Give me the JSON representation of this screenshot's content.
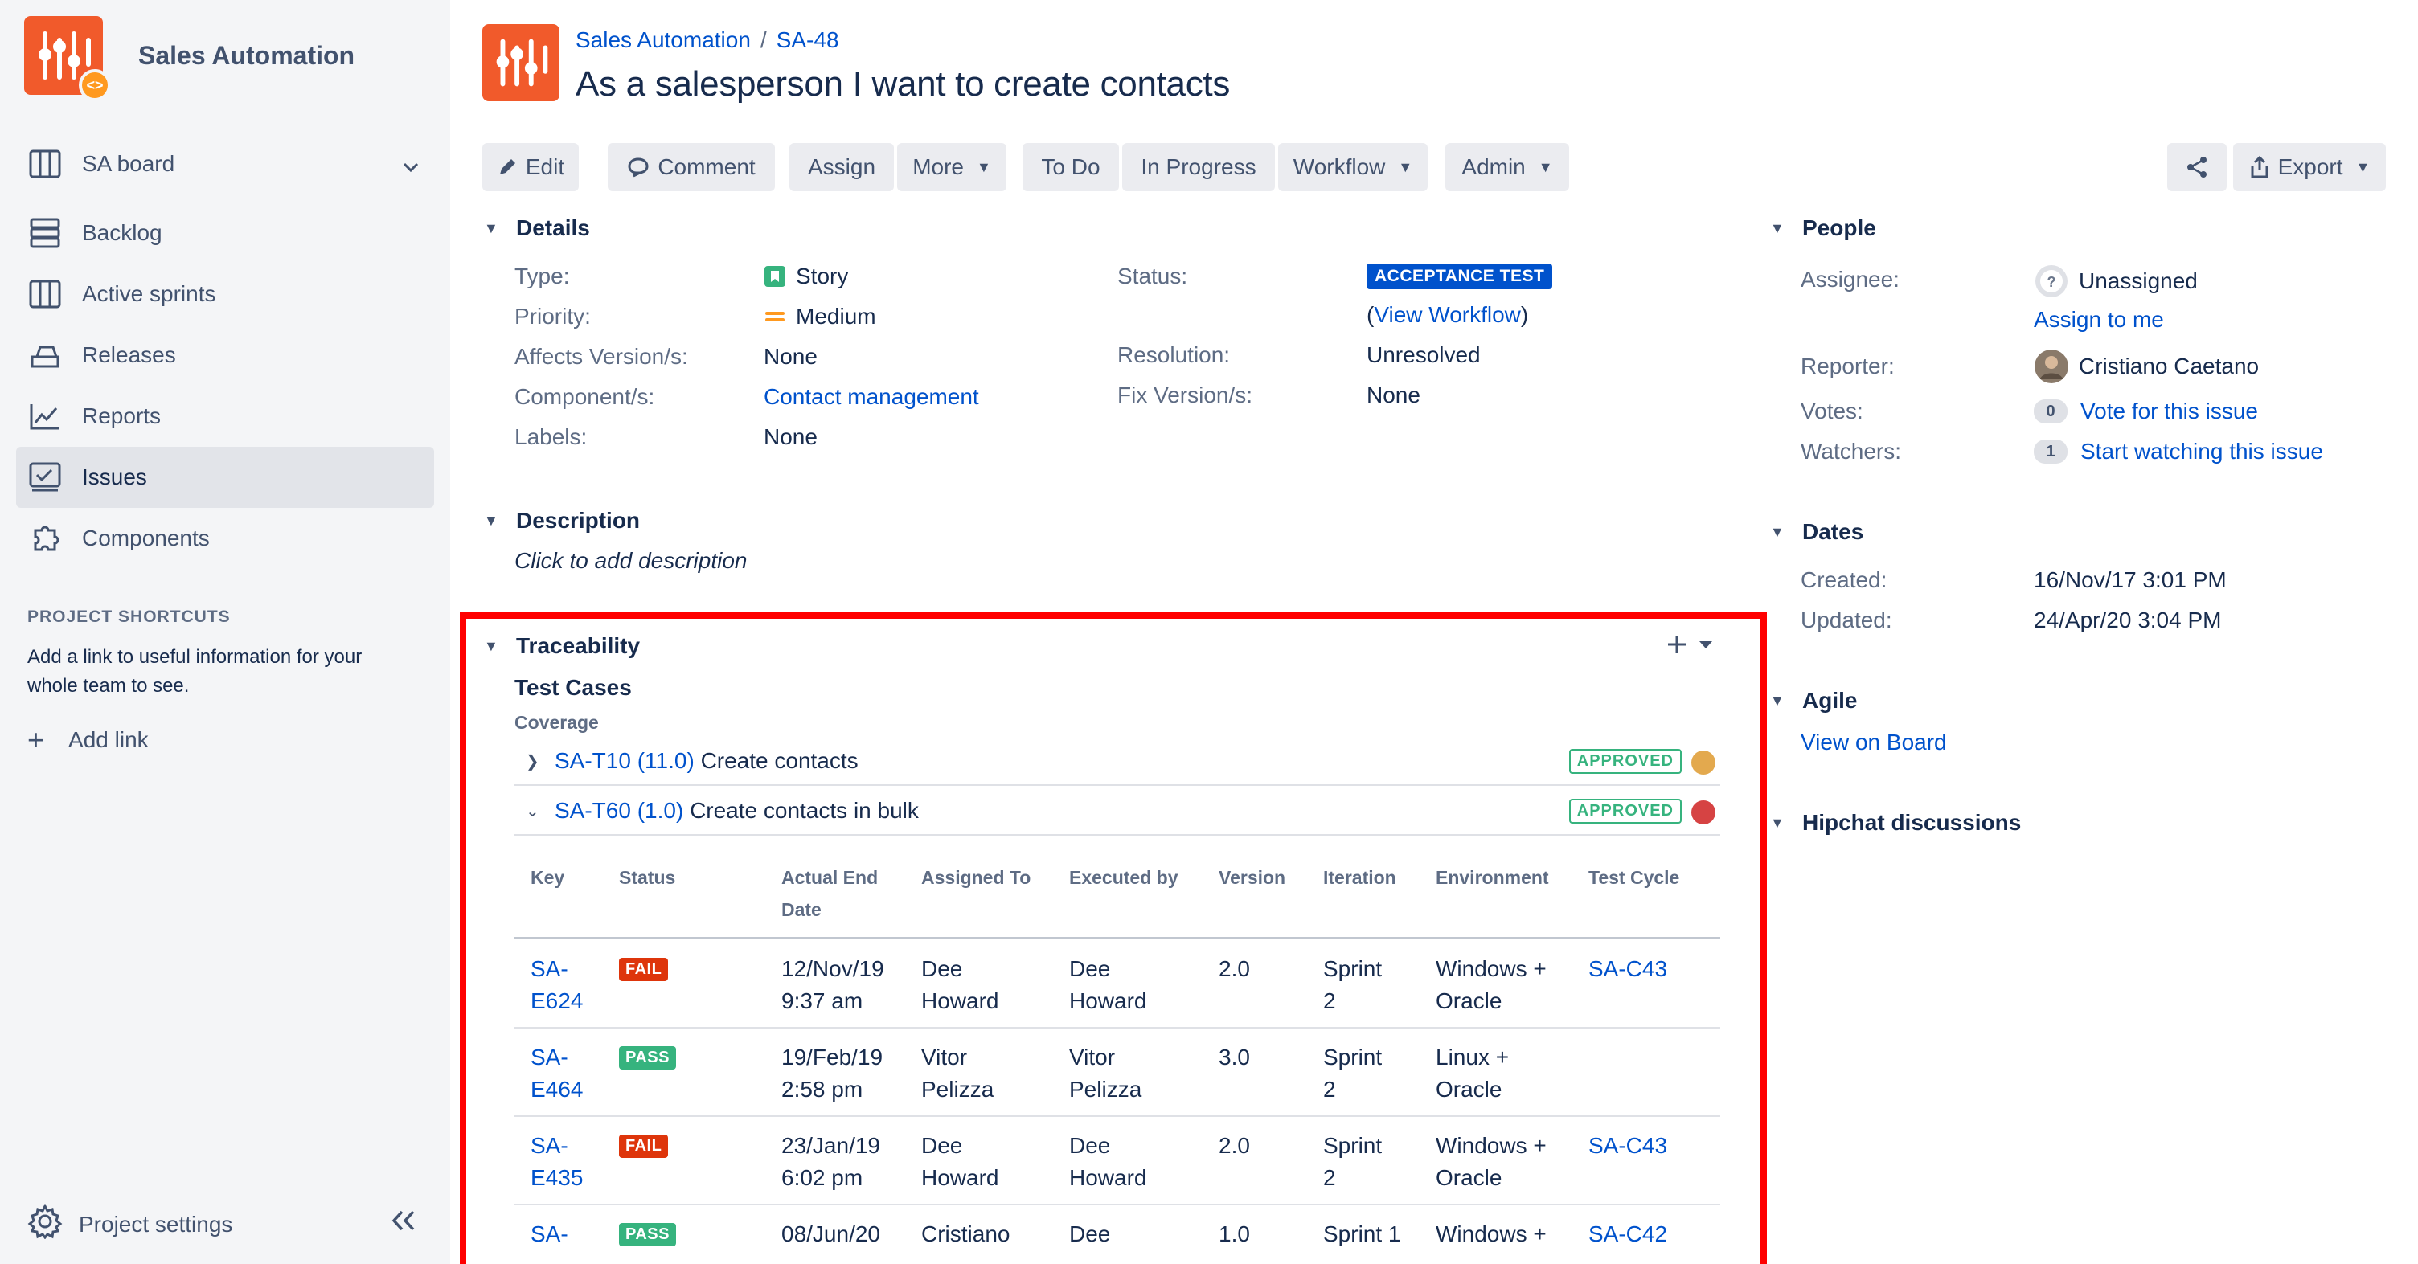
{
  "sidebar": {
    "project_name": "Sales Automation",
    "nav": [
      {
        "label": "SA board",
        "icon": "board-icon",
        "has_chevron": true
      },
      {
        "label": "Backlog",
        "icon": "backlog-icon"
      },
      {
        "label": "Active sprints",
        "icon": "active-sprints-icon"
      },
      {
        "label": "Releases",
        "icon": "releases-icon"
      },
      {
        "label": "Reports",
        "icon": "reports-icon"
      },
      {
        "label": "Issues",
        "icon": "issues-icon",
        "active": true
      },
      {
        "label": "Components",
        "icon": "components-icon"
      }
    ],
    "shortcuts_title": "PROJECT SHORTCUTS",
    "shortcuts_text": "Add a link to useful information for your whole team to see.",
    "add_link": "Add link",
    "project_settings": "Project settings"
  },
  "header": {
    "breadcrumb_project": "Sales Automation",
    "breadcrumb_sep": "/",
    "breadcrumb_key": "SA-48",
    "title": "As a salesperson I want to create contacts"
  },
  "toolbar": {
    "edit": "Edit",
    "comment": "Comment",
    "assign": "Assign",
    "more": "More",
    "todo": "To Do",
    "in_progress": "In Progress",
    "workflow": "Workflow",
    "admin": "Admin",
    "export": "Export"
  },
  "details": {
    "heading": "Details",
    "type_label": "Type:",
    "type_value": "Story",
    "priority_label": "Priority:",
    "priority_value": "Medium",
    "affects_label": "Affects Version/s:",
    "affects_value": "None",
    "component_label": "Component/s:",
    "component_value": "Contact management",
    "labels_label": "Labels:",
    "labels_value": "None",
    "status_label": "Status:",
    "status_value": "ACCEPTANCE TEST",
    "view_workflow": "View Workflow",
    "resolution_label": "Resolution:",
    "resolution_value": "Unresolved",
    "fix_label": "Fix Version/s:",
    "fix_value": "None"
  },
  "description": {
    "heading": "Description",
    "placeholder": "Click to add description"
  },
  "people": {
    "heading": "People",
    "assignee_label": "Assignee:",
    "assignee_value": "Unassigned",
    "assign_to_me": "Assign to me",
    "reporter_label": "Reporter:",
    "reporter_value": "Cristiano Caetano",
    "votes_label": "Votes:",
    "votes_count": "0",
    "votes_link": "Vote for this issue",
    "watchers_label": "Watchers:",
    "watchers_count": "1",
    "watchers_link": "Start watching this issue"
  },
  "dates": {
    "heading": "Dates",
    "created_label": "Created:",
    "created_value": "16/Nov/17 3:01 PM",
    "updated_label": "Updated:",
    "updated_value": "24/Apr/20 3:04 PM"
  },
  "agile": {
    "heading": "Agile",
    "view_on_board": "View on Board"
  },
  "hipchat": {
    "heading": "Hipchat discussions"
  },
  "traceability": {
    "heading": "Traceability",
    "test_cases": "Test Cases",
    "coverage": "Coverage",
    "cases": [
      {
        "key": "SA-T10 (11.0)",
        "name": "Create contacts",
        "status": "APPROVED",
        "dot_color": "#e3a94e",
        "expanded": false
      },
      {
        "key": "SA-T60 (1.0)",
        "name": "Create contacts in bulk",
        "status": "APPROVED",
        "dot_color": "#d64343",
        "expanded": true
      }
    ],
    "columns": [
      "Key",
      "Status",
      "Actual End Date",
      "Assigned To",
      "Executed by",
      "Version",
      "Iteration",
      "Environment",
      "Test Cycle"
    ],
    "rows": [
      {
        "key1": "SA-",
        "key2": "E624",
        "status": "FAIL",
        "date1": "12/Nov/19",
        "date2": "9:37 am",
        "assigned1": "Dee",
        "assigned2": "Howard",
        "executed1": "Dee",
        "executed2": "Howard",
        "version": "2.0",
        "iter1": "Sprint",
        "iter2": "2",
        "env1": "Windows +",
        "env2": "Oracle",
        "cycle": "SA-C43"
      },
      {
        "key1": "SA-",
        "key2": "E464",
        "status": "PASS",
        "date1": "19/Feb/19",
        "date2": "2:58 pm",
        "assigned1": "Vitor",
        "assigned2": "Pelizza",
        "executed1": "Vitor",
        "executed2": "Pelizza",
        "version": "3.0",
        "iter1": "Sprint",
        "iter2": "2",
        "env1": "Linux +",
        "env2": "Oracle",
        "cycle": ""
      },
      {
        "key1": "SA-",
        "key2": "E435",
        "status": "FAIL",
        "date1": "23/Jan/19",
        "date2": "6:02 pm",
        "assigned1": "Dee",
        "assigned2": "Howard",
        "executed1": "Dee",
        "executed2": "Howard",
        "version": "2.0",
        "iter1": "Sprint",
        "iter2": "2",
        "env1": "Windows +",
        "env2": "Oracle",
        "cycle": "SA-C43"
      },
      {
        "key1": "SA-",
        "key2": "",
        "status": "PASS",
        "date1": "08/Jun/20",
        "date2": "",
        "assigned1": "Cristiano",
        "assigned2": "",
        "executed1": "Dee",
        "executed2": "",
        "version": "1.0",
        "iter1": "Sprint 1",
        "iter2": "",
        "env1": "Windows +",
        "env2": "",
        "cycle": "SA-C42"
      }
    ]
  },
  "colors": {
    "brand": "#f15a2b",
    "link": "#0052cc",
    "highlight_frame": "#ff0000",
    "fail": "#de350b",
    "pass": "#36b37e"
  }
}
